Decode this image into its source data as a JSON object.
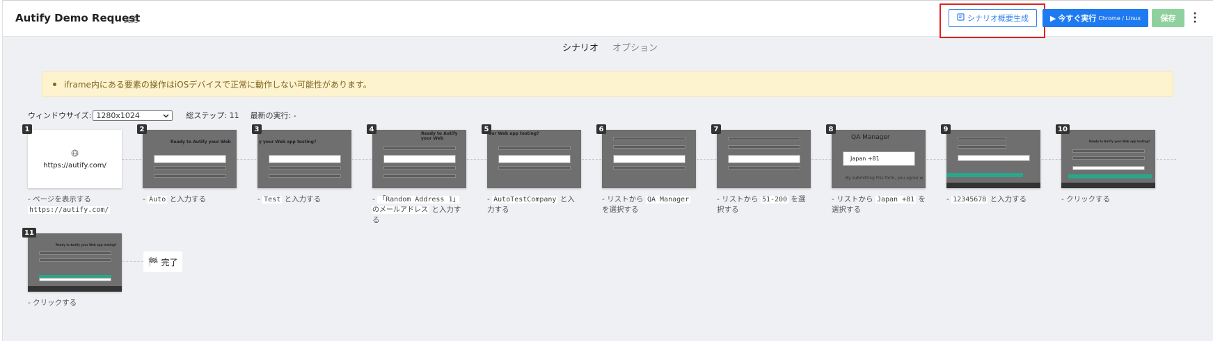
{
  "header": {
    "title": "Autify Demo Request",
    "change_label": "変更",
    "summary_button": "シナリオ概要生成",
    "run_button": "今すぐ実行",
    "run_button_sub": "Chrome / Linux",
    "save_button": "保存"
  },
  "tabs": [
    {
      "label": "シナリオ",
      "active": true
    },
    {
      "label": "オプション",
      "active": false
    }
  ],
  "warning": "iframe内にある要素の操作はiOSデバイスで正常に動作しない可能性があります。",
  "meta": {
    "window_size_label": "ウィンドウサイズ:",
    "window_size_value": "1280x1024",
    "total_steps": "総ステップ: 11",
    "last_run": "最新の実行: -"
  },
  "steps": [
    {
      "num": "1",
      "prefix": "- ページを表示する ",
      "code": "https://autify.com/",
      "suffix": "",
      "thumb_url": "https://autify.com/"
    },
    {
      "num": "2",
      "prefix": "- ",
      "code": "Auto",
      "suffix": " と入力する",
      "thumb_title": "Ready to Autify your Web"
    },
    {
      "num": "3",
      "prefix": "- ",
      "code": "Test",
      "suffix": " と入力する",
      "thumb_title": "y your Web app testing?"
    },
    {
      "num": "4",
      "prefix": "- ",
      "code": "「Random Address 1」のメールアドレス",
      "suffix": " と入力する",
      "thumb_title": "Ready to Autify your Web"
    },
    {
      "num": "5",
      "prefix": "- ",
      "code": "AutoTestCompany",
      "suffix": " と入力する",
      "thumb_title": "our Web app testing?"
    },
    {
      "num": "6",
      "prefix": "- リストから ",
      "code": "QA Manager",
      "suffix": " を選択する"
    },
    {
      "num": "7",
      "prefix": "- リストから ",
      "code": "51-200",
      "suffix": " を選択する"
    },
    {
      "num": "8",
      "prefix": "- リストから ",
      "code": "Japan +81",
      "suffix": " を選択する",
      "thumb_label": "QA Manager",
      "thumb_field": "Japan   +81",
      "thumb_note": "By submitting this form, you agree w"
    },
    {
      "num": "9",
      "prefix": "- ",
      "code": "12345678",
      "suffix": " と入力する"
    },
    {
      "num": "10",
      "prefix": "- クリックする",
      "code": "",
      "suffix": "",
      "thumb_title": "Ready to Autify your Web app testing?"
    },
    {
      "num": "11",
      "prefix": "- クリックする",
      "code": "",
      "suffix": "",
      "thumb_title": "Ready to Autify your Web app testing?"
    }
  ],
  "done_label": "完了"
}
